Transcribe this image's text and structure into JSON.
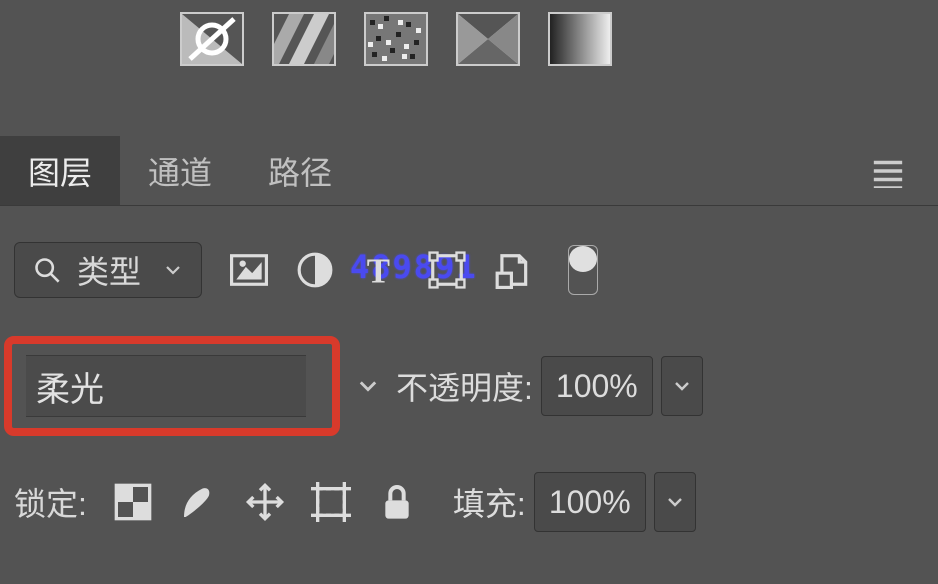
{
  "watermark": "489891",
  "tabs": {
    "layers": "图层",
    "channels": "通道",
    "paths": "路径"
  },
  "filter": {
    "type_label": "类型"
  },
  "blend": {
    "mode": "柔光",
    "opacity_label": "不透明度:",
    "opacity_value": "100%"
  },
  "lock": {
    "label": "锁定:",
    "fill_label": "填充:",
    "fill_value": "100%"
  }
}
